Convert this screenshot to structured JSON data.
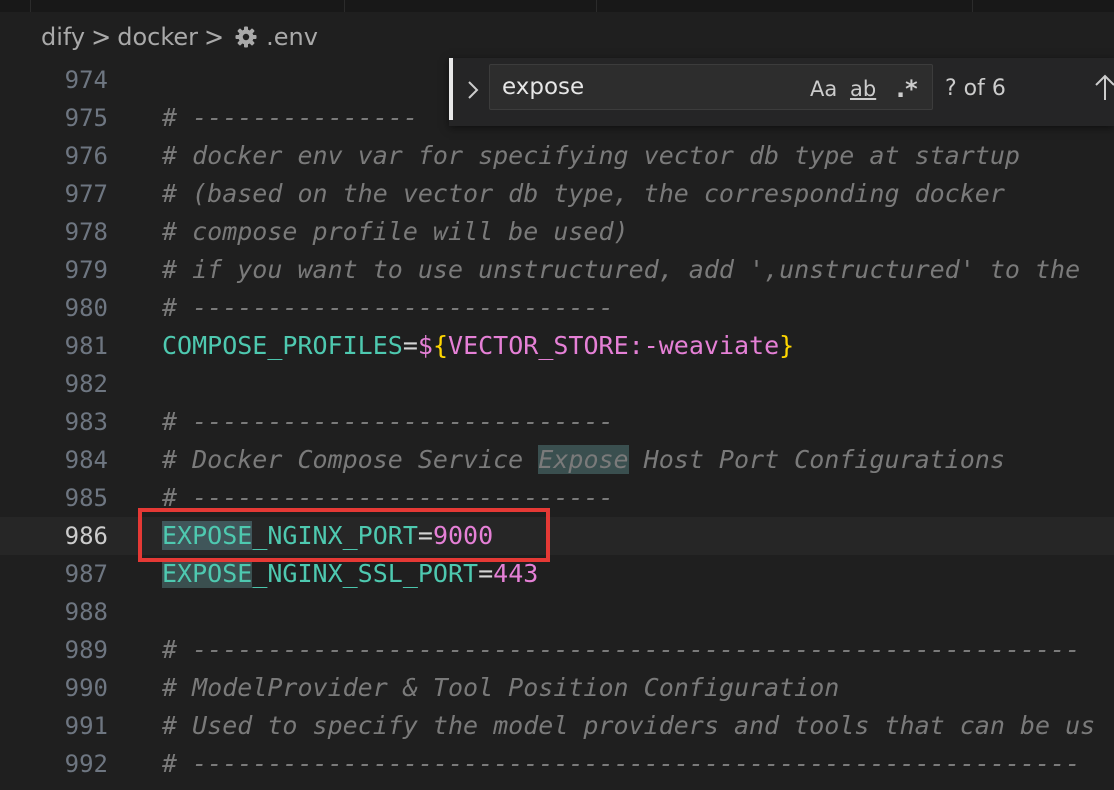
{
  "breadcrumb": {
    "items": [
      "dify",
      "docker",
      ".env"
    ],
    "separator": ">",
    "file_icon": "gear-icon"
  },
  "find_widget": {
    "query": "expose",
    "match_case_label": "Aa",
    "whole_word_label": "ab",
    "regex_label": ".*",
    "match_count": "? of 6",
    "toggle_icon": "chevron-right-icon",
    "prev_icon": "arrow-up-icon"
  },
  "editor": {
    "current_line": "986",
    "lines": [
      {
        "num": "974",
        "text": ""
      },
      {
        "num": "975",
        "text": "# ---------------"
      },
      {
        "num": "976",
        "text": "# docker env var for specifying vector db type at startup"
      },
      {
        "num": "977",
        "text": "# (based on the vector db type, the corresponding docker"
      },
      {
        "num": "978",
        "text": "# compose profile will be used)"
      },
      {
        "num": "979",
        "text": "# if you want to use unstructured, add ',unstructured' to the"
      },
      {
        "num": "980",
        "text": "# ----------------------------"
      },
      {
        "num": "981",
        "key": "COMPOSE_PROFILES",
        "eq": "=",
        "dollar": "$",
        "lbrace": "{",
        "var": "VECTOR_STORE:-weaviate",
        "rbrace": "}"
      },
      {
        "num": "982",
        "text": ""
      },
      {
        "num": "983",
        "text": "# ----------------------------"
      },
      {
        "num": "984",
        "pre": "# Docker Compose Service ",
        "match": "Expose",
        "post": " Host Port Configurations"
      },
      {
        "num": "985",
        "text": "# ----------------------------"
      },
      {
        "num": "986",
        "match": "EXPOSE",
        "key": "_NGINX_PORT",
        "eq": "=",
        "value": "9000"
      },
      {
        "num": "987",
        "match": "EXPOSE",
        "key": "_NGINX_SSL_PORT",
        "eq": "=",
        "value": "443"
      },
      {
        "num": "988",
        "text": ""
      },
      {
        "num": "989",
        "text": "# -----------------------------------------------------------"
      },
      {
        "num": "990",
        "text": "# ModelProvider & Tool Position Configuration"
      },
      {
        "num": "991",
        "text": "# Used to specify the model providers and tools that can be us"
      },
      {
        "num": "992",
        "text": "# -----------------------------------------------------------"
      }
    ]
  },
  "colors": {
    "background": "#1f1f1f",
    "comment": "#7a7a7a",
    "key": "#4ec9b0",
    "value": "#e580d6",
    "brace": "#ffd700",
    "highlight_box": "#e53935"
  }
}
